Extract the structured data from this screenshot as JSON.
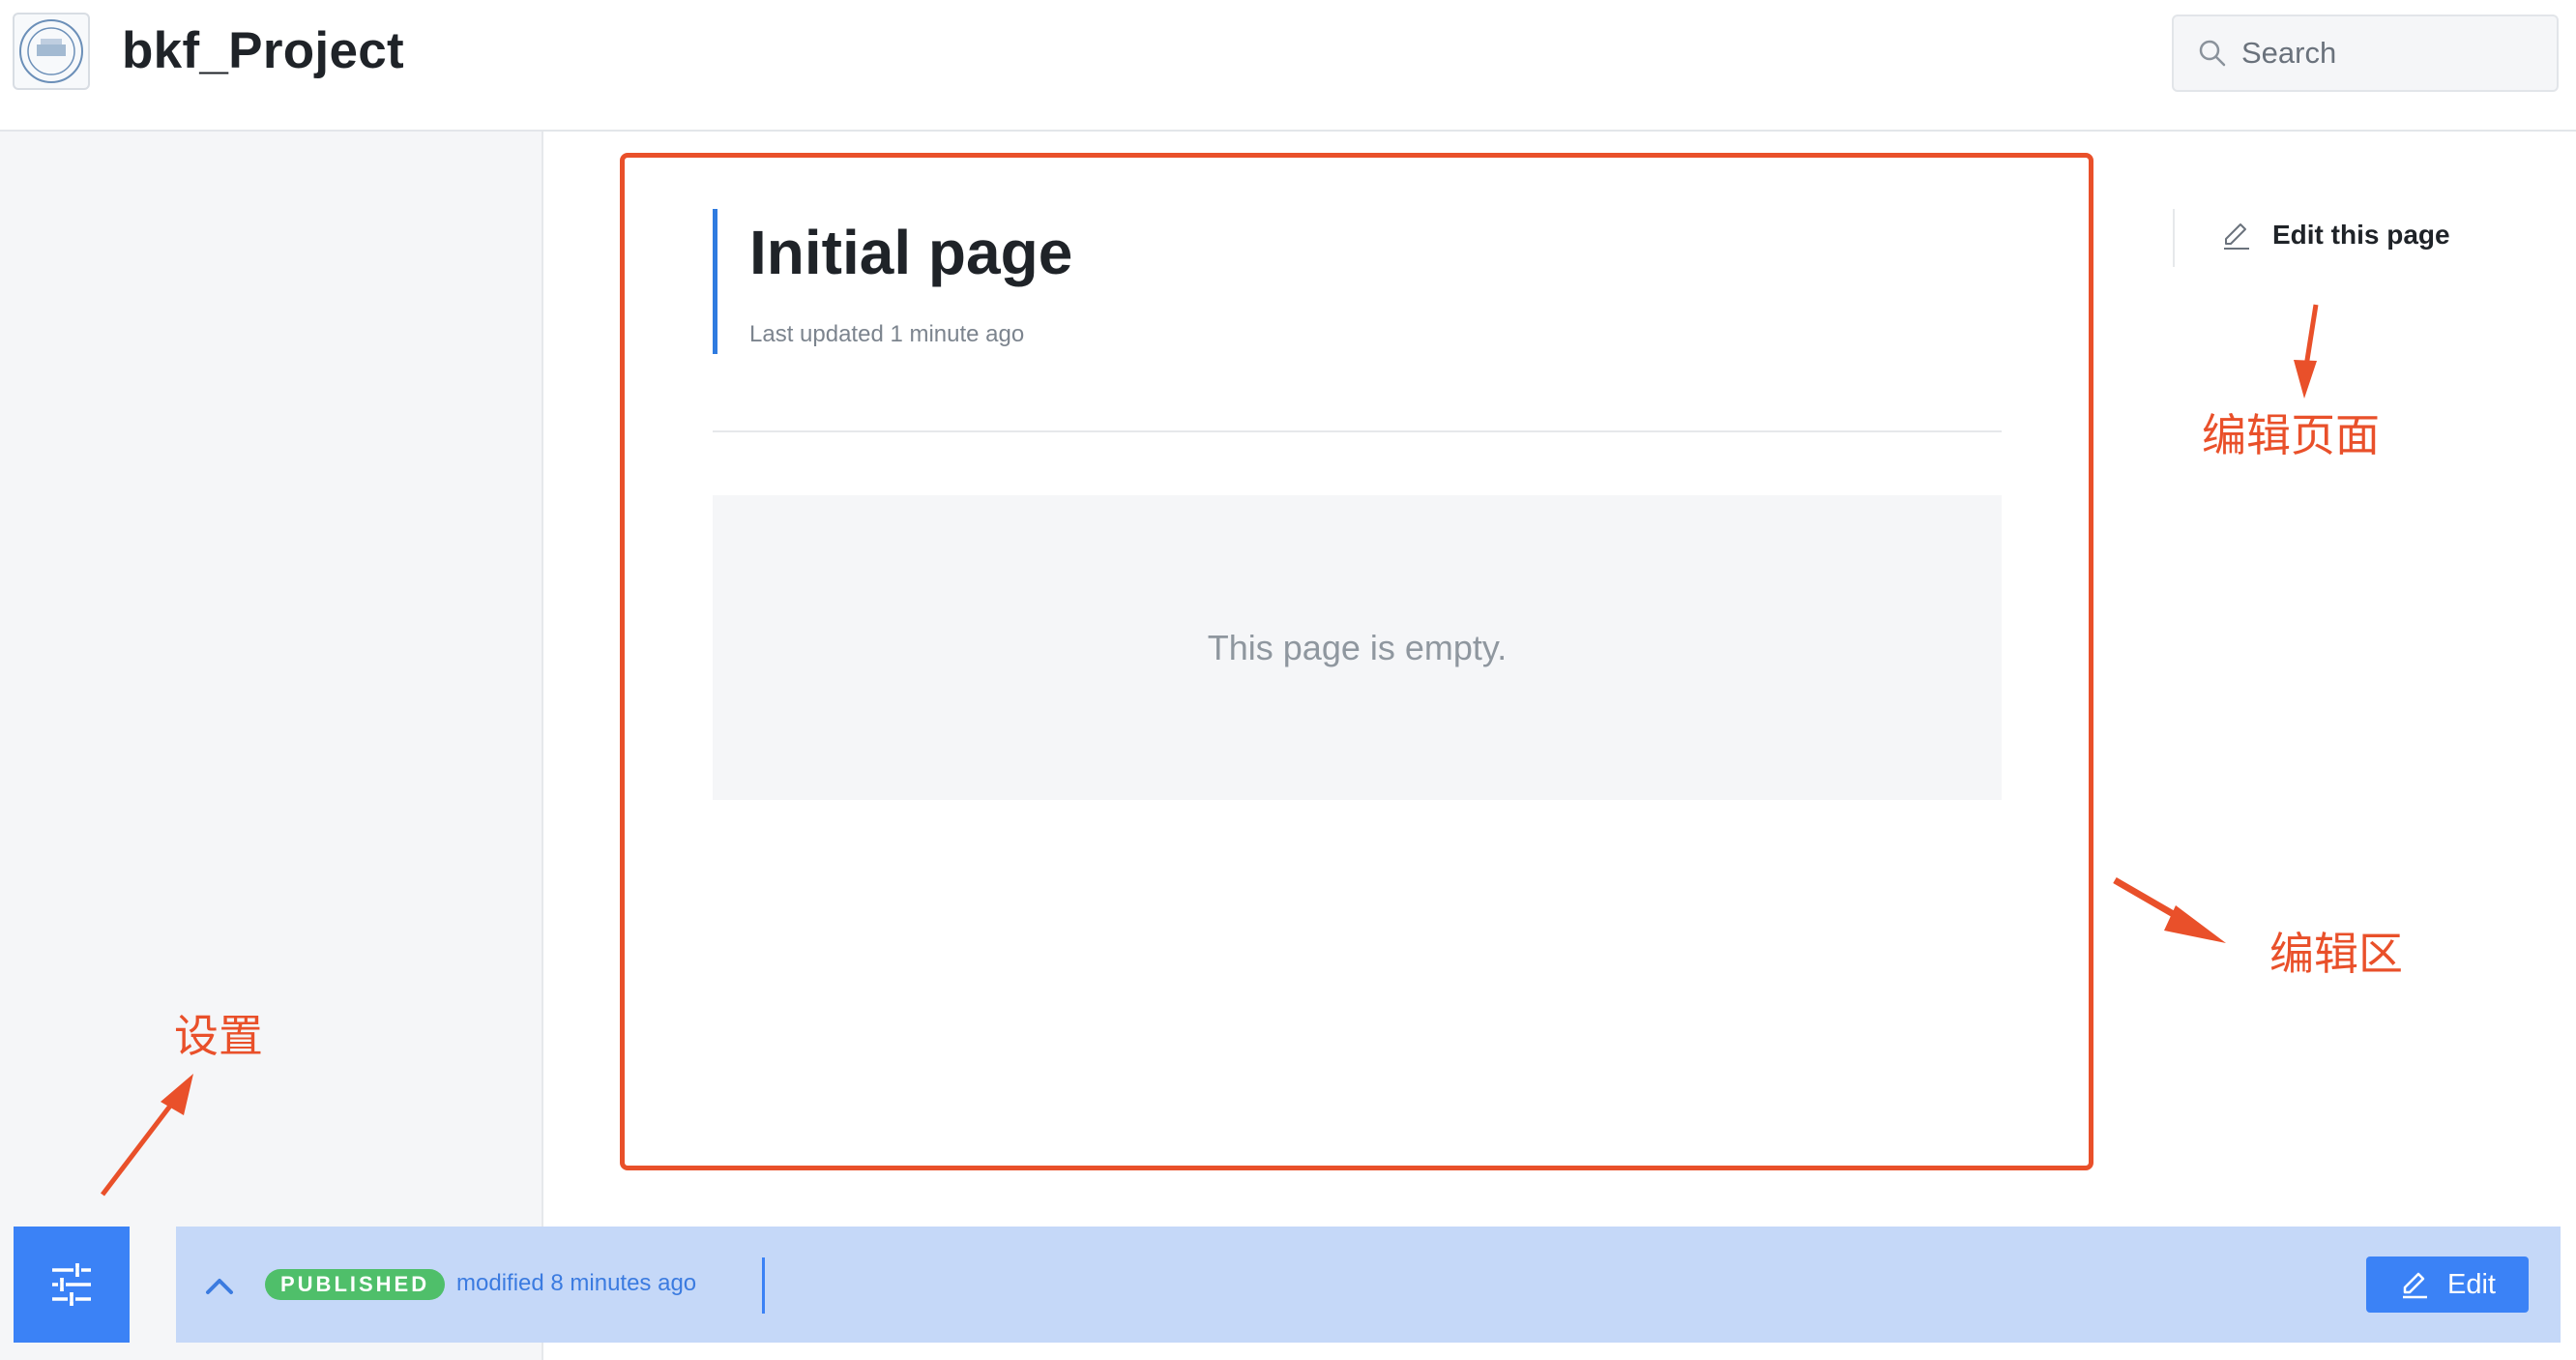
{
  "header": {
    "project_title": "bkf_Project",
    "search_placeholder": "Search"
  },
  "page": {
    "title": "Initial page",
    "last_updated": "Last updated 1 minute ago",
    "empty_message": "This page is empty."
  },
  "right_panel": {
    "edit_this_page": "Edit this page"
  },
  "annotations": {
    "edit_page": "编辑页面",
    "edit_area": "编辑区",
    "settings": "设置",
    "color": "#e9502a"
  },
  "status_bar": {
    "badge": "PUBLISHED",
    "modified": "modified 8 minutes ago",
    "edit_label": "Edit"
  },
  "colors": {
    "accent": "#3b82f6",
    "published": "#4fbf6a",
    "status_bar_bg": "#c5d8f8"
  },
  "icons": [
    "logo-icon",
    "search-icon",
    "pencil-icon",
    "sliders-icon",
    "chevron-up-icon"
  ]
}
